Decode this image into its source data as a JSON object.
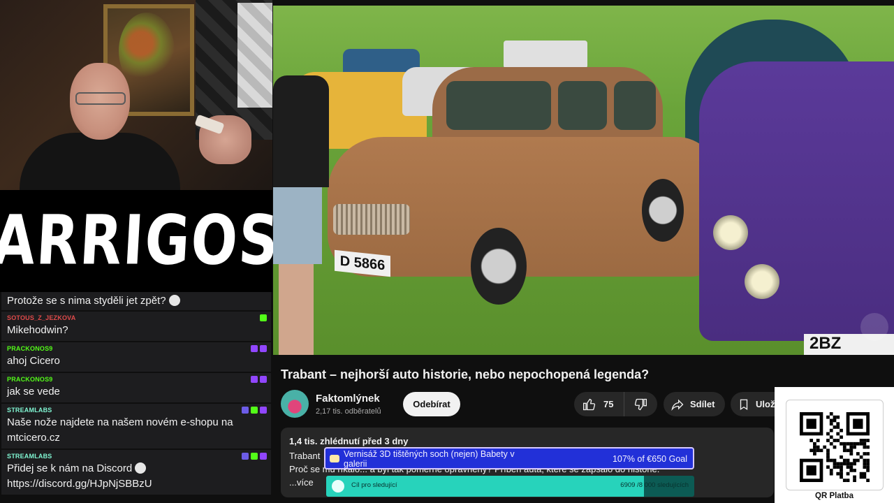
{
  "webcam": {
    "streamer_logo": "ARRIGOS"
  },
  "chat": {
    "messages": [
      {
        "user": "",
        "user_color": "#ffffff",
        "text": "Protože se s nima styděli jet zpět?",
        "badges": []
      },
      {
        "user": "SOTOUS_Z_JEZKOVA",
        "user_color": "#e04a4a",
        "text": "Mikehodwin?",
        "badges": [
          "kick-icon"
        ]
      },
      {
        "user": "PRACKONOS9",
        "user_color": "#53fc18",
        "text": "ahoj Cicero",
        "badges": [
          "twitch-icon",
          "twitch-icon"
        ]
      },
      {
        "user": "PRACKONOS9",
        "user_color": "#53fc18",
        "text": "jak se vede",
        "badges": [
          "twitch-icon",
          "twitch-icon"
        ]
      },
      {
        "user": "STREAMLABS",
        "user_color": "#80f5d2",
        "text": "Naše nože najdete na našem novém e-shopu na mtcicero.cz",
        "badges": [
          "mod-icon",
          "streamlabs-icon",
          "twitch-icon"
        ]
      },
      {
        "user": "STREAMLABS",
        "user_color": "#80f5d2",
        "text": "Přidej se k nám na Discord",
        "text2": "https://discord.gg/HJpNjSBBzU",
        "badges": [
          "mod-icon",
          "streamlabs-icon",
          "twitch-icon"
        ]
      }
    ]
  },
  "video": {
    "plate_front": "D 5866",
    "plate_right": "2BZ"
  },
  "youtube": {
    "title": "Trabant – nejhorší auto historie, nebo nepochopená legenda?",
    "channel_name": "Faktomlýnek",
    "channel_subs": "2,17 tis. odběratelů",
    "subscribe_label": "Odebírat",
    "like_count": "75",
    "share_label": "Sdílet",
    "save_label": "Uložit",
    "description": {
      "meta": "1,4 tis. zhlédnutí  před 3 dny",
      "line1": "Trabant",
      "line2": "Proč se mu říkalo... a byl tak poměrně oprávněný? Příběh auta, které se zapsalo do historie.",
      "more": "...více"
    }
  },
  "overlays": {
    "goal": {
      "title": "Vernisáž 3D tištěných soch (nejen) Babety v galerii",
      "progress_text": "107% of €650 Goal"
    },
    "follow_goal": {
      "label": "Cíl pro sledující",
      "count_text": "6909 /8 000 sledujících",
      "fraction": 0.8636
    }
  },
  "qr": {
    "label": "QR Platba"
  },
  "colors": {
    "subscribe_bg": "#f1f1f1",
    "pill_bg": "#272727",
    "goal_bg": "#2230d8",
    "follow_fill": "#27d3bb"
  }
}
